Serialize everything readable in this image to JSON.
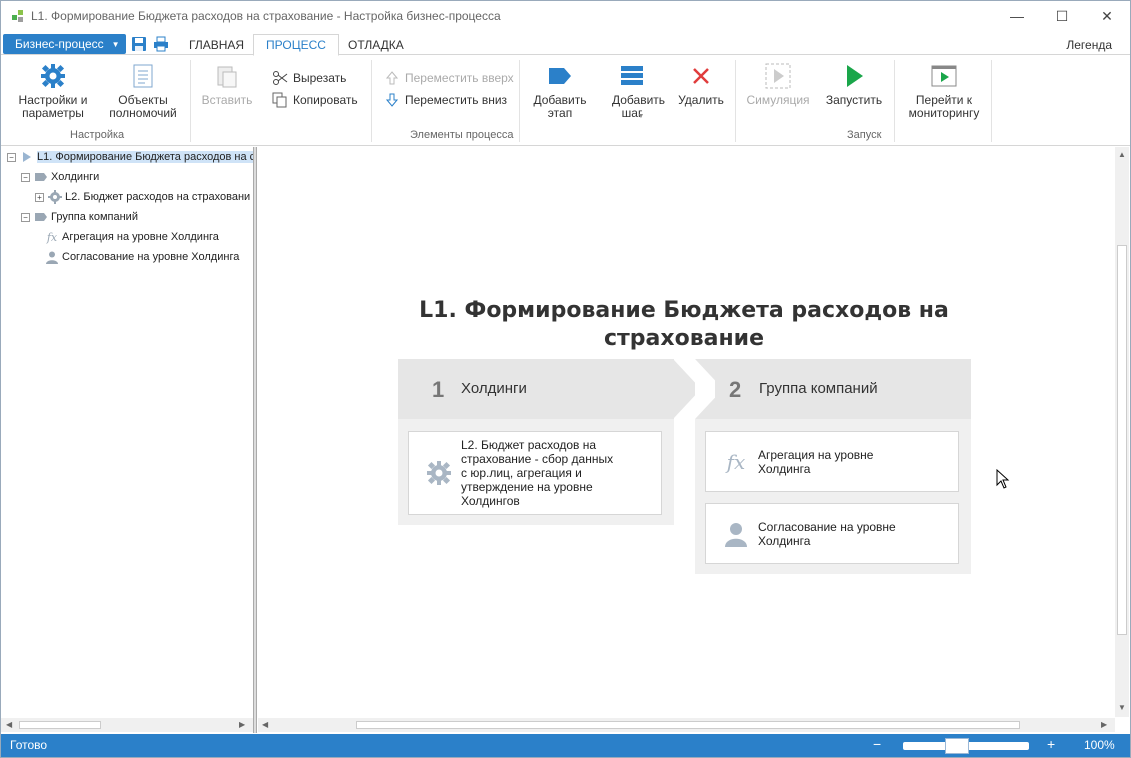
{
  "window": {
    "title": "L1. Формирование Бюджета расходов на страхование - Настройка бизнес-процесса",
    "controls": [
      "—",
      "☐",
      "✕"
    ]
  },
  "menu": {
    "app_button": "Бизнес-процесс",
    "tabs": [
      "ГЛАВНАЯ",
      "ПРОЦЕСС",
      "ОТЛАДКА"
    ],
    "active_tab": "ПРОЦЕСС",
    "legend": "Легенда"
  },
  "ribbon": {
    "settings_group": {
      "label": "Настройка",
      "settings_btn": "Настройки и параметры",
      "objects_btn": "Объекты полномочий"
    },
    "elements_group": {
      "label": "Элементы процесса",
      "paste_btn": "Вставить",
      "cut_btn": "Вырезать",
      "copy_btn": "Копировать",
      "move_up_btn": "Переместить вверх",
      "move_down_btn": "Переместить вниз",
      "add_stage_btn": "Добавить этап",
      "add_step_btn": "Добавить шаг",
      "delete_btn": "Удалить"
    },
    "run_group": {
      "label": "Запуск",
      "simulation_btn": "Симуляция",
      "run_btn": "Запустить",
      "monitor_btn": "Перейти к мониторингу"
    },
    "colors": {
      "accent": "#2b80c9",
      "delete": "#e03c3c",
      "run": "#1aa64a"
    }
  },
  "tree": {
    "root": "L1. Формирование Бюджета расходов на с",
    "stage1": "Холдинги",
    "stage1_child": "L2. Бюджет расходов на страховани",
    "stage2": "Группа компаний",
    "stage2_child1": "Агрегация на уровне Холдинга",
    "stage2_child2": "Согласование на уровне Холдинга"
  },
  "diagram": {
    "title_line1": "L1. Формирование Бюджета расходов на",
    "title_line2": "страхование",
    "stage1": {
      "number": "1",
      "name": "Холдинги",
      "step1_lines": [
        "L2. Бюджет расходов на",
        "страхование - сбор данных",
        "с юр.лиц, агрегация и",
        "утверждение на уровне",
        "Холдингов"
      ]
    },
    "stage2": {
      "number": "2",
      "name": "Группа компаний",
      "step1_lines": [
        "Агрегация на уровне",
        "Холдинга"
      ],
      "step2_lines": [
        "Согласование на уровне",
        "Холдинга"
      ]
    }
  },
  "statusbar": {
    "status": "Готово",
    "zoom_minus": "−",
    "zoom_plus": "+",
    "zoom": "100%"
  }
}
